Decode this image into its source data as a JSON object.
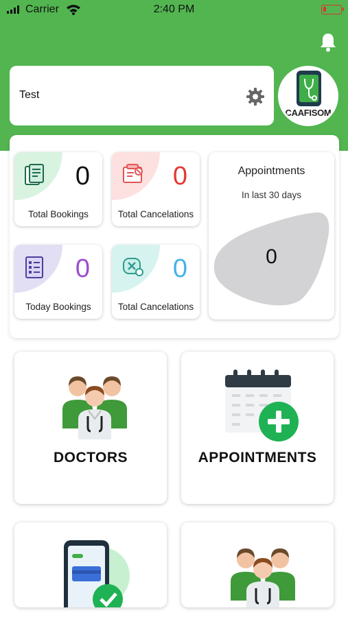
{
  "status_bar": {
    "carrier": "Carrier",
    "time": "2:40 PM"
  },
  "user": {
    "name": "Test"
  },
  "logo": {
    "text": "CAAFISOM"
  },
  "stats": {
    "total_bookings": {
      "value": "0",
      "label": "Total Bookings",
      "color": "#111111",
      "accent": "#d9f3e1"
    },
    "total_cancelations": {
      "value": "0",
      "label": "Total Cancelations",
      "color": "#e53935",
      "accent": "#fde0e0"
    },
    "today_bookings": {
      "value": "0",
      "label": "Today Bookings",
      "color": "#9c4dcc",
      "accent": "#e2def3"
    },
    "today_cancelations": {
      "value": "0",
      "label": "Total Cancelations",
      "color": "#46b3e6",
      "accent": "#d6f3ef"
    }
  },
  "appointments_summary": {
    "title": "Appointments",
    "subtitle": "In last 30 days",
    "value": "0"
  },
  "tiles": [
    {
      "label": "DOCTORS",
      "icon": "doctors-icon"
    },
    {
      "label": "APPOINTMENTS",
      "icon": "calendar-add-icon"
    },
    {
      "label": "",
      "icon": "phone-payment-icon"
    },
    {
      "label": "",
      "icon": "doctors-icon"
    }
  ],
  "colors": {
    "brand_green": "#52b550",
    "battery_red": "#e03030"
  }
}
